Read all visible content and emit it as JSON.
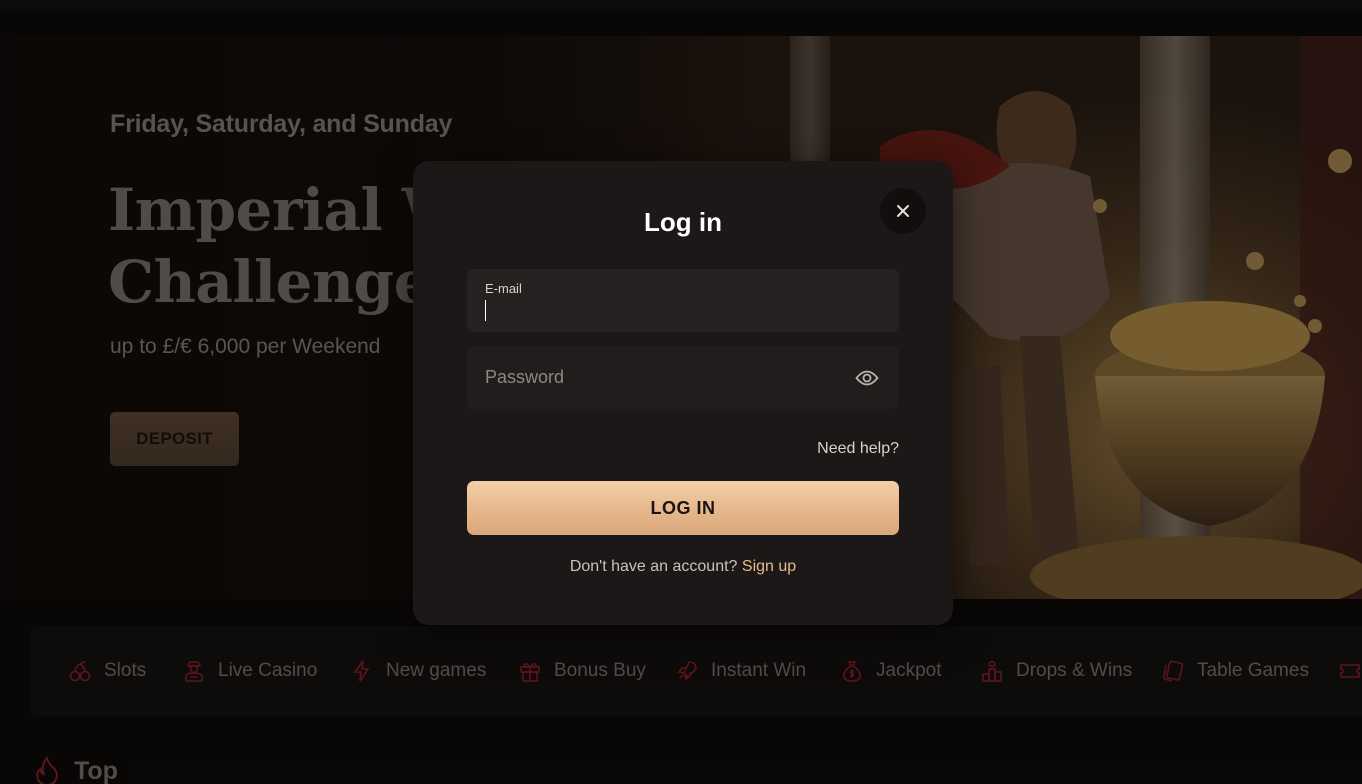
{
  "hero": {
    "subtitle": "Friday, Saturday, and Sunday",
    "title": "Imperial Wealth Challenge",
    "offer": "up to £/€ 6,000 per Weekend",
    "deposit_label": "DEPOSIT"
  },
  "categories": [
    {
      "label": "Slots",
      "icon": "cherries-icon"
    },
    {
      "label": "Live Casino",
      "icon": "dealer-icon"
    },
    {
      "label": "New games",
      "icon": "lightning-icon"
    },
    {
      "label": "Bonus Buy",
      "icon": "gift-icon"
    },
    {
      "label": "Instant Win",
      "icon": "rocket-icon"
    },
    {
      "label": "Jackpot",
      "icon": "money-bag-icon"
    },
    {
      "label": "Drops & Wins",
      "icon": "podium-icon"
    },
    {
      "label": "Table Games",
      "icon": "cards-icon"
    }
  ],
  "section": {
    "heading": "Top",
    "icon": "flame-icon"
  },
  "login_modal": {
    "title": "Log in",
    "email_label": "E-mail",
    "email_value": "",
    "password_placeholder": "Password",
    "help_link": "Need help?",
    "submit_label": "LOG IN",
    "signup_prompt": "Don't have an account?",
    "signup_link": "Sign up"
  },
  "colors": {
    "accent": "#e8b987",
    "button_gradient_top": "#f3cfa6",
    "icon_red": "#a3262b",
    "modal_bg": "#1c1817"
  }
}
